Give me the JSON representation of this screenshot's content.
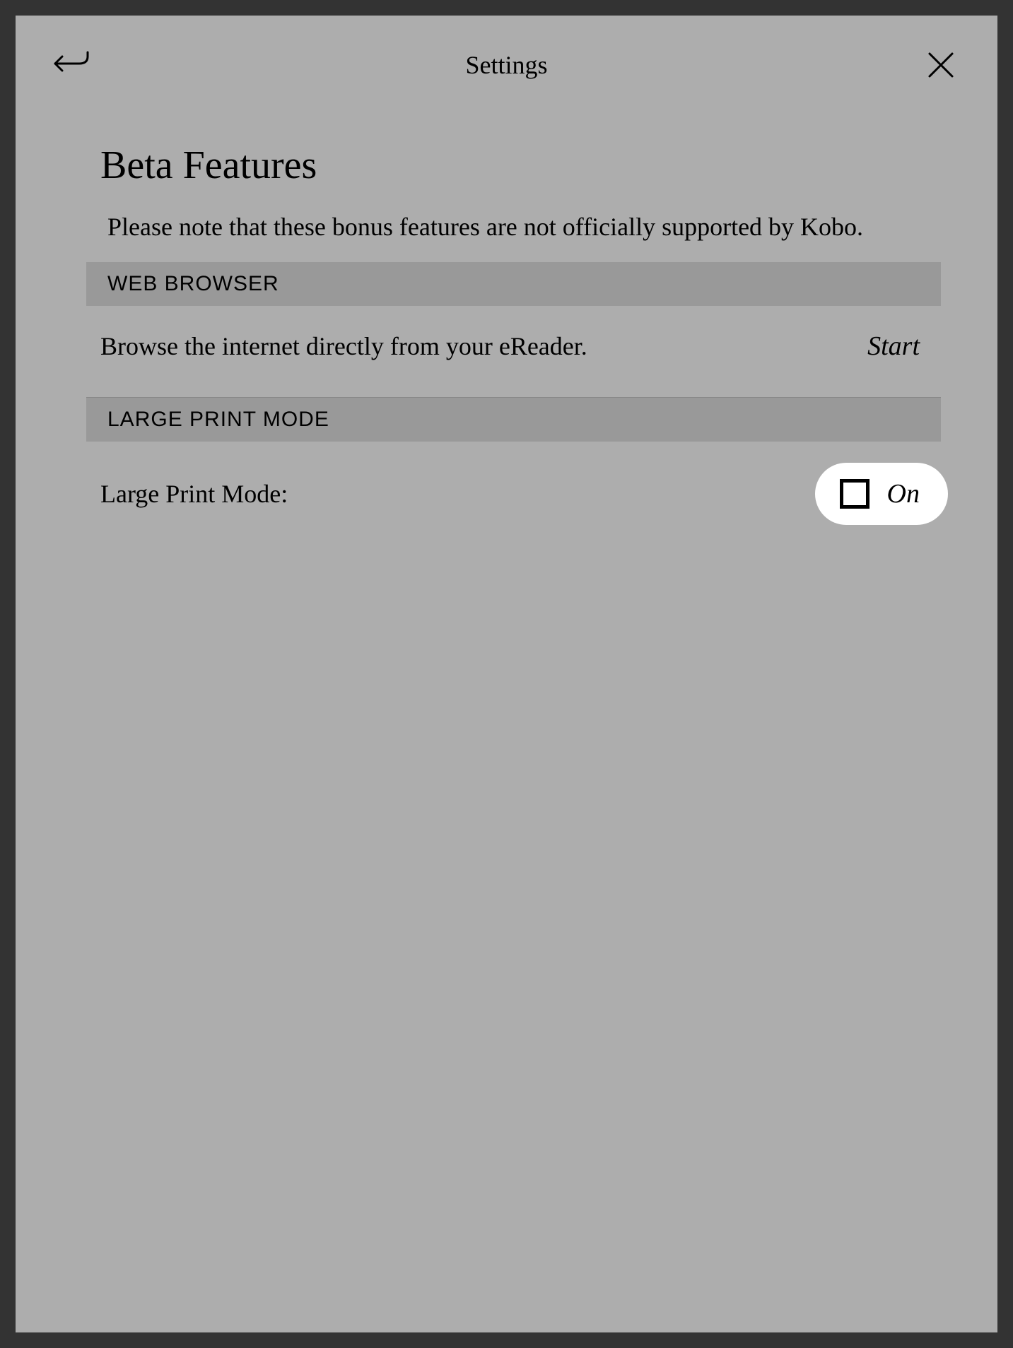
{
  "header": {
    "title": "Settings"
  },
  "page": {
    "title": "Beta Features",
    "description": "Please note that these bonus features are not officially supported by Kobo."
  },
  "sections": {
    "web_browser": {
      "header": "WEB BROWSER",
      "description": "Browse the internet directly from your eReader.",
      "action": "Start"
    },
    "large_print": {
      "header": "LARGE PRINT MODE",
      "label": "Large Print Mode:",
      "toggle_state": "On"
    }
  }
}
